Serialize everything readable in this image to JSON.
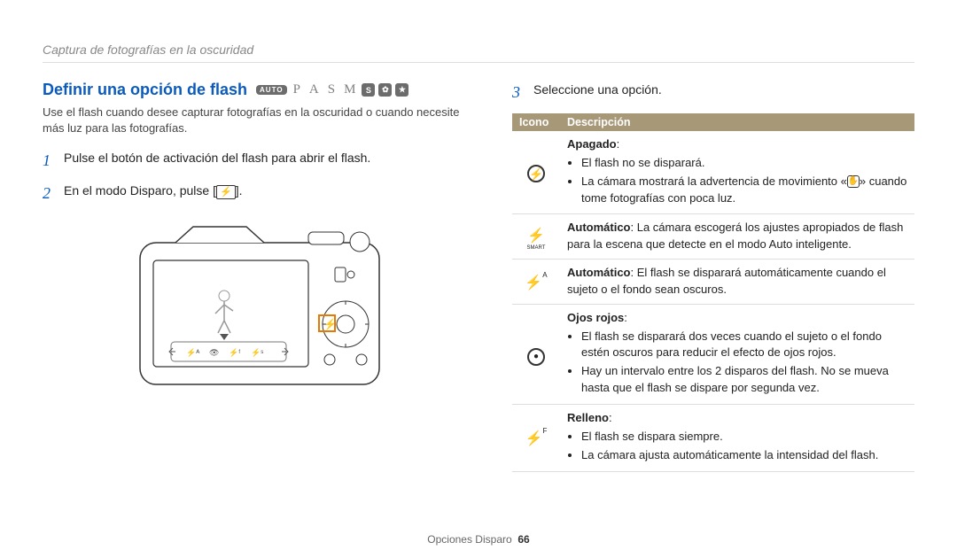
{
  "breadcrumb": "Captura de fotografías en la oscuridad",
  "title": "Definir una opción de flash",
  "modes": {
    "auto": "AUTO",
    "letters": [
      "P",
      "A",
      "S",
      "M"
    ]
  },
  "intro": "Use el flash cuando desee capturar fotografías en la oscuridad o cuando necesite más luz para las fotografías.",
  "step1": "Pulse el botón de activación del flash para abrir el flash.",
  "step2_pre": "En el modo Disparo, pulse [",
  "step2_post": "].",
  "step3": "Seleccione una opción.",
  "table": {
    "head_icon": "Icono",
    "head_desc": "Descripción",
    "rows": [
      {
        "icon": "⊘",
        "title": "Apagado",
        "bullets": [
          "El flash no se disparará.",
          "La cámara mostrará la advertencia de movimiento «✋» cuando tome fotografías con poca luz."
        ]
      },
      {
        "icon": "⚡",
        "sub": "SMART",
        "desc_bold": "Automático",
        "desc_rest": ": La cámara escogerá los ajustes apropiados de flash para la escena que detecte en el modo Auto inligente.",
        "desc_rest_full": ": La cámara escogerá los ajustes apropiados de flash para la escena que detecte en el modo Auto inteligente."
      },
      {
        "icon": "⚡",
        "sup": "A",
        "desc_bold": "Automático",
        "desc_rest_full": ": El flash se disparará automáticamente cuando el sujeto o el fondo sean oscuros."
      },
      {
        "icon": "👁",
        "title": "Ojos rojos",
        "bullets": [
          "El flash se disparará dos veces cuando el sujeto o el fondo estén oscuros para reducir el efecto de ojos rojos.",
          "Hay un intervalo entre los 2 disparos del flash. No se mueva hasta que el flash se dispare por segunda vez."
        ]
      },
      {
        "icon": "⚡",
        "sup": "F",
        "title": "Relleno",
        "bullets": [
          "El flash se dispara siempre.",
          "La cámara ajusta automáticamente la intensidad del flash."
        ]
      }
    ]
  },
  "footer_label": "Opciones Disparo",
  "footer_page": "66"
}
